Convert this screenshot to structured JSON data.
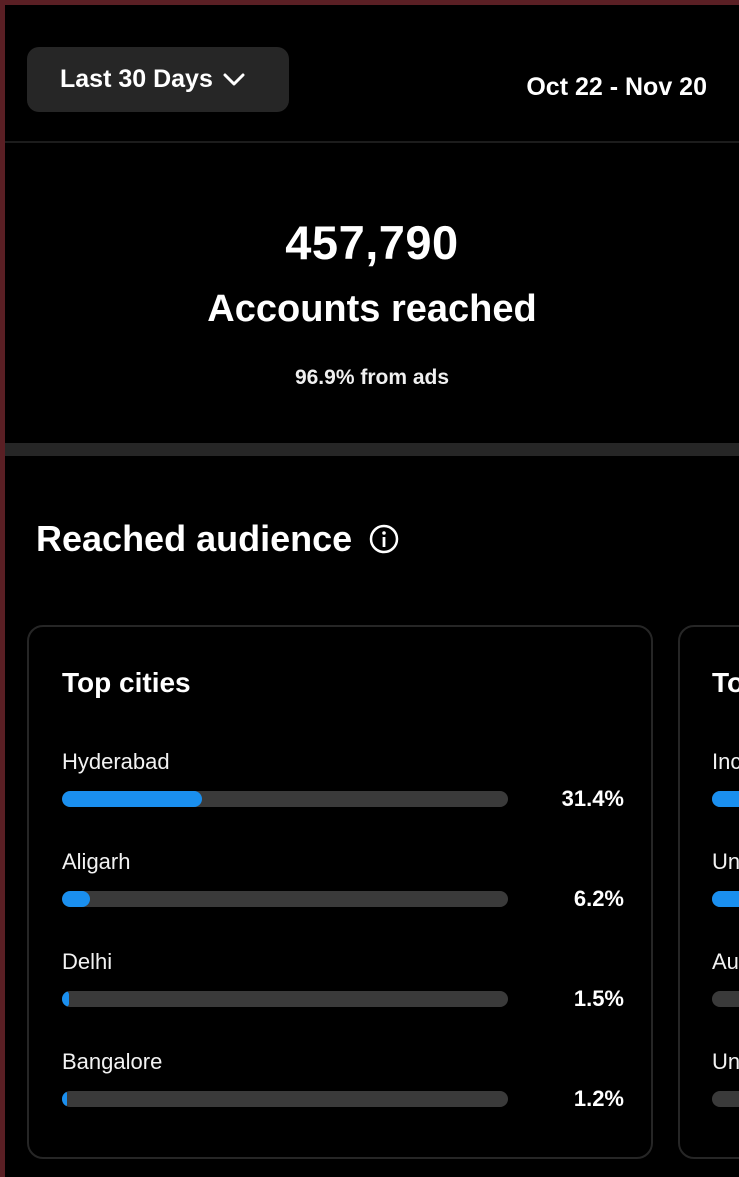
{
  "header": {
    "filter_label": "Last 30 Days",
    "date_range": "Oct 22 - Nov 20"
  },
  "summary": {
    "value": "457,790",
    "label": "Accounts reached",
    "sub": "96.9% from ads"
  },
  "audience": {
    "title": "Reached audience",
    "top_cities": {
      "title": "Top cities",
      "items": [
        {
          "name": "Hyderabad",
          "pct": "31.4%",
          "value": 31.4
        },
        {
          "name": "Aligarh",
          "pct": "6.2%",
          "value": 6.2
        },
        {
          "name": "Delhi",
          "pct": "1.5%",
          "value": 1.5
        },
        {
          "name": "Bangalore",
          "pct": "1.2%",
          "value": 1.2
        }
      ]
    },
    "top_countries": {
      "title": "To",
      "items": [
        {
          "name": "Inc",
          "fill": 1
        },
        {
          "name": "Un",
          "fill": 1
        },
        {
          "name": "Au",
          "fill": 0
        },
        {
          "name": "Un",
          "fill": 0
        }
      ]
    }
  },
  "colors": {
    "accent": "#1a8fef",
    "track": "#3a3a3a"
  }
}
